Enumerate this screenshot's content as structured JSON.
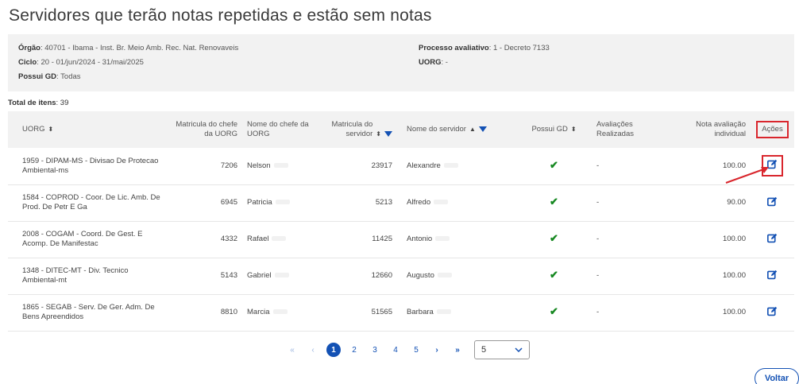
{
  "page": {
    "title": "Servidores que terão notas repetidas e estão sem notas"
  },
  "info": {
    "orgao_label": "Órgão",
    "orgao_value": ": 40701 - Ibama - Inst. Br. Meio Amb. Rec. Nat. Renovaveis",
    "ciclo_label": "Ciclo",
    "ciclo_value": ": 20 - 01/jun/2024 - 31/mai/2025",
    "gd_label": "Possui GD",
    "gd_value": ": Todas",
    "processo_label": "Processo avaliativo",
    "processo_value": ": 1 - Decreto 7133",
    "uorg_label": "UORG",
    "uorg_value": ": -"
  },
  "total": {
    "label": "Total de itens",
    "value": ": 39"
  },
  "table": {
    "headers": {
      "uorg": "UORG",
      "mat_chefe": "Matricula do chefe da UORG",
      "nome_chefe": "Nome do chefe da UORG",
      "mat_servidor": "Matricula do servidor",
      "nome_servidor": "Nome do servidor",
      "possui_gd": "Possui GD",
      "avaliacoes": "Avaliações Realizadas",
      "nota": "Nota avaliação individual",
      "acoes": "Ações"
    },
    "rows": [
      {
        "uorg": "1959 - DIPAM-MS - Divisao De Protecao Ambiental-ms",
        "mat_chefe": "7206",
        "nome_chefe": "Nelson",
        "mat_servidor": "23917",
        "nome_servidor": "Alexandre",
        "avaliacoes": "-",
        "nota": "100.00"
      },
      {
        "uorg": "1584 - COPROD - Coor. De Lic. Amb. De Prod. De Petr E Ga",
        "mat_chefe": "6945",
        "nome_chefe": "Patricia",
        "mat_servidor": "5213",
        "nome_servidor": "Alfredo",
        "avaliacoes": "-",
        "nota": "90.00"
      },
      {
        "uorg": "2008 - COGAM - Coord. De Gest. E Acomp. De Manifestac",
        "mat_chefe": "4332",
        "nome_chefe": "Rafael",
        "mat_servidor": "11425",
        "nome_servidor": "Antonio",
        "avaliacoes": "-",
        "nota": "100.00"
      },
      {
        "uorg": "1348 - DITEC-MT - Div. Tecnico Ambiental-mt",
        "mat_chefe": "5143",
        "nome_chefe": "Gabriel",
        "mat_servidor": "12660",
        "nome_servidor": "Augusto",
        "avaliacoes": "-",
        "nota": "100.00"
      },
      {
        "uorg": "1865 - SEGAB - Serv. De Ger. Adm. De Bens Apreendidos",
        "mat_chefe": "8810",
        "nome_chefe": "Marcia",
        "mat_servidor": "51565",
        "nome_servidor": "Barbara",
        "avaliacoes": "-",
        "nota": "100.00"
      }
    ]
  },
  "pagination": {
    "first": "«",
    "prev": "‹",
    "pages": [
      "1",
      "2",
      "3",
      "4",
      "5"
    ],
    "current": "1",
    "next": "›",
    "last": "»",
    "page_size": "5"
  },
  "actions": {
    "voltar": "Voltar"
  },
  "colors": {
    "primary": "#1351b4",
    "highlight": "#d9262d",
    "success": "#168821"
  },
  "icons": {
    "sort": "sort-icon",
    "filter": "filter-icon",
    "check": "check-icon",
    "edit": "edit-icon",
    "arrow": "red-arrow"
  }
}
